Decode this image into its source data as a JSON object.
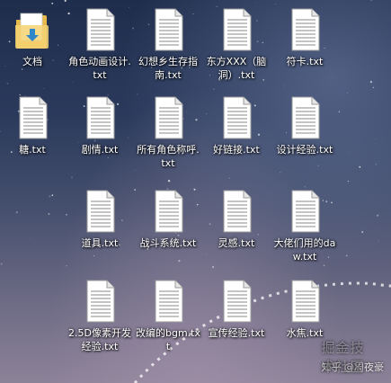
{
  "desktop": {
    "folder": {
      "label": "文档",
      "icon": "folder-icon"
    },
    "files": [
      {
        "label": "角色动画设计.txt",
        "icon": "text-file-icon"
      },
      {
        "label": "幻想乡生存指南.txt",
        "icon": "text-file-icon"
      },
      {
        "label": "东方XXX（脑洞）.txt",
        "icon": "text-file-icon"
      },
      {
        "label": "符卡.txt",
        "icon": "text-file-icon"
      },
      {
        "label": "糖.txt",
        "icon": "text-file-icon"
      },
      {
        "label": "剧情.txt",
        "icon": "text-file-icon"
      },
      {
        "label": "所有角色称呼.txt",
        "icon": "text-file-icon"
      },
      {
        "label": "好链接.txt",
        "icon": "text-file-icon"
      },
      {
        "label": "设计经验.txt",
        "icon": "text-file-icon"
      },
      {
        "label": "道具.txt",
        "icon": "text-file-icon"
      },
      {
        "label": "战斗系统.txt",
        "icon": "text-file-icon"
      },
      {
        "label": "灵感.txt",
        "icon": "text-file-icon"
      },
      {
        "label": "大佬们用的daw.txt",
        "icon": "text-file-icon"
      },
      {
        "label": "2.5D像素开发经验.txt",
        "icon": "text-file-icon"
      },
      {
        "label": "改编的bgm.txt",
        "icon": "text-file-icon"
      },
      {
        "label": "宣传经验.txt",
        "icon": "text-file-icon"
      },
      {
        "label": "水焦.txt",
        "icon": "text-file-icon"
      }
    ]
  },
  "watermark": {
    "text": "知乎 @周夜豪",
    "ghost": "掘金技术社区"
  }
}
